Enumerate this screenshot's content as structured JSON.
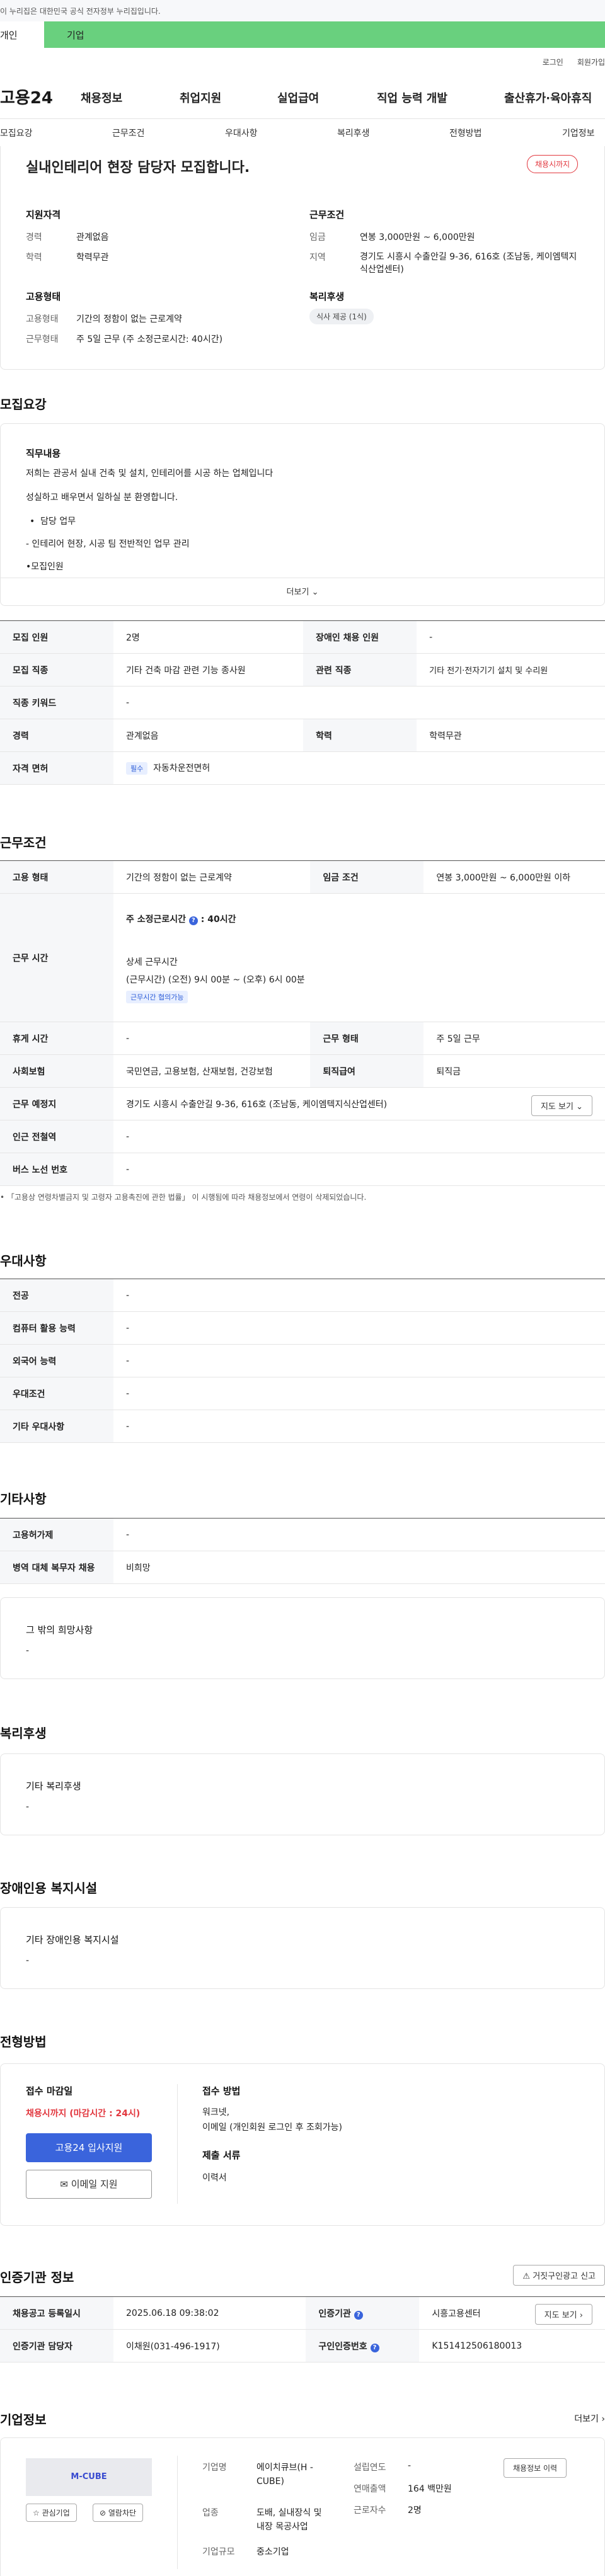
{
  "gov_notice": "이 누리집은 대한민국 공식 전자정부 누리집입니다.",
  "user_tabs": {
    "individual": "개인",
    "corporate": "기업"
  },
  "top_links": {
    "login": "로그인",
    "signup": "회원가입"
  },
  "logo": "고용24",
  "gnb": [
    "채용정보",
    "취업지원",
    "실업급여",
    "직업 능력 개발",
    "출산휴가·육아휴직"
  ],
  "subnav": [
    "모집요강",
    "근무조건",
    "우대사항",
    "복리후생",
    "전형방법",
    "기업정보"
  ],
  "job": {
    "title": "실내인테리어 현장 담당자 모집합니다.",
    "status_badge": "채용시까지",
    "qual": {
      "title": "지원자격",
      "career_l": "경력",
      "career": "관계없음",
      "edu_l": "학력",
      "edu": "학력무관"
    },
    "cond": {
      "title": "근무조건",
      "wage_l": "임금",
      "wage": "연봉 3,000만원 ~ 6,000만원",
      "area_l": "지역",
      "area": "경기도 시흥시 수출안길 9-36, 616호 (조남동, 케이엠텍지식산업센터)"
    },
    "emp": {
      "title": "고용형태",
      "type_l": "고용형태",
      "type": "기간의 정함이 없는 근로계약",
      "hours_l": "근무형태",
      "hours": "주 5일 근무 (주 소정근로시간: 40시간)"
    },
    "welfare": {
      "title": "복리후생",
      "pill": "식사 제공 (1식)"
    }
  },
  "recruit": {
    "heading": "모집요강",
    "duty_title": "직무내용",
    "lines": [
      "저희는 관공서 실내 건축 및 설치, 인테리어를 시공 하는 업체입니다",
      "성실하고 배우면서 일하실 분 환영합니다."
    ],
    "bullet": "담당 업무",
    "line3": "- 인테리어 현장, 시공 팀 전반적인 업무 관리",
    "line4": "•모집인원",
    "more": "더보기",
    "rows": [
      {
        "l1": "모집 인원",
        "v1": "2명",
        "l2": "장애인 채용 인원",
        "v2": "-"
      },
      {
        "l1": "모집 직종",
        "v1": "기타 건축 마감 관련 기능 종사원",
        "l2": "관련 직종",
        "v2": "기타 전기·전자기기 설치 및 수리원"
      },
      {
        "l1": "직종 키워드",
        "v1": "-"
      },
      {
        "l1": "경력",
        "v1": "관계없음",
        "l2": "학력",
        "v2": "학력무관"
      },
      {
        "l1": "자격 면허",
        "chip": "필수",
        "v1": "자동차운전면허"
      }
    ]
  },
  "work": {
    "heading": "근무조건",
    "r1": {
      "l1": "고용 형태",
      "v1": "기간의 정함이 없는 근로계약",
      "l2": "임금 조건",
      "v2": "연봉 3,000만원 ~ 6,000만원 이하"
    },
    "hours": {
      "label": "근무 시간",
      "weekly": "주 소정근로시간",
      "weekly_v": "40시간",
      "detail_t": "상세 근무시간",
      "detail": "(근무시간) (오전) 9시 00분 ~ (오후) 6시 00분",
      "chip": "근무시간 협의가능"
    },
    "r3": {
      "l1": "휴게 시간",
      "v1": "-",
      "l2": "근무 형태",
      "v2": "주 5일 근무"
    },
    "r4": {
      "l1": "사회보험",
      "v1": "국민연금, 고용보험, 산재보험, 건강보험",
      "l2": "퇴직급여",
      "v2": "퇴직금"
    },
    "r5": {
      "l1": "근무 예정지",
      "v1": "경기도 시흥시 수출안길 9-36, 616호 (조남동, 케이엠텍지식산업센터)",
      "btn": "지도 보기"
    },
    "r6": {
      "l1": "인근 전철역",
      "v1": "-"
    },
    "r7": {
      "l1": "버스 노선 번호",
      "v1": "-"
    },
    "note": "• 「고용상 연령차별금지 및 고령자 고용촉진에 관한 법률」 이 시행됨에 따라 채용정보에서 연령이 삭제되었습니다."
  },
  "pref": {
    "heading": "우대사항",
    "rows": [
      {
        "l": "전공",
        "v": "-"
      },
      {
        "l": "컴퓨터 활용 능력",
        "v": "-"
      },
      {
        "l": "외국어 능력",
        "v": "-"
      },
      {
        "l": "우대조건",
        "v": "-"
      },
      {
        "l": "기타 우대사항",
        "v": "-"
      }
    ]
  },
  "etc": {
    "heading": "기타사항",
    "rows": [
      {
        "l": "고용허가제",
        "v": "-"
      },
      {
        "l": "병역 대체 복무자 채용",
        "v": "비희망"
      }
    ],
    "hope_t": "그 밖의 희망사항",
    "hope_v": "-"
  },
  "benefit": {
    "heading": "복리후생",
    "t": "기타 복리후생",
    "v": "-"
  },
  "disab": {
    "heading": "장애인용 복지시설",
    "t": "기타 장애인용 복지시설",
    "v": "-"
  },
  "proc": {
    "heading": "전형방법",
    "deadline_t": "접수 마감일",
    "deadline": "채용시까지 (마감시간 : 24시)",
    "apply": "고용24 입사지원",
    "email": "이메일 지원",
    "method_t": "접수 방법",
    "method1": "워크넷,",
    "method2": "이메일 (개인회원 로그인 후 조회가능)",
    "docs_t": "제출 서류",
    "docs": "이력서"
  },
  "cert": {
    "heading": "인증기관 정보",
    "report": "거짓구인광고 신고",
    "r1": {
      "l1": "채용공고 등록일시",
      "v1": "2025.06.18 09:38:02",
      "l2": "인증기관",
      "v2": "시흥고용센터",
      "btn": "지도 보기"
    },
    "r2": {
      "l1": "인증기관 담당자",
      "v1": "이채원(031-496-1917)",
      "l2": "구인인증번호",
      "v2": "K151412506180013"
    }
  },
  "company": {
    "heading": "기업정보",
    "more": "더보기",
    "logo_text": "M-CUBE",
    "interest": "관심기업",
    "block": "열람차단",
    "name_l": "기업명",
    "name": "에이치큐브(H - CUBE)",
    "ind_l": "업종",
    "ind": "도배, 실내장식 및 내장 목공사업",
    "size_l": "기업규모",
    "size": "중소기업",
    "est_l": "설립연도",
    "est": "-",
    "sales_l": "연매출액",
    "sales": "164 백만원",
    "emp_l": "근로자수",
    "emp": "2명",
    "hire_btn": "채용정보 이력"
  }
}
